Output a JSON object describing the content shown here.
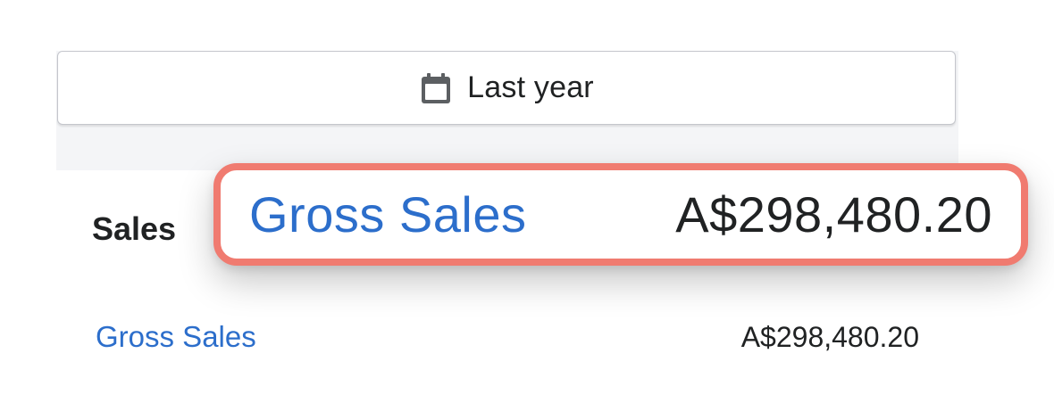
{
  "date_picker": {
    "label": "Last year",
    "icon": "calendar-icon"
  },
  "section": {
    "title": "Sales"
  },
  "rows": [
    {
      "label": "Gross Sales",
      "value": "A$298,480.20"
    }
  ],
  "callout": {
    "label": "Gross Sales",
    "value": "A$298,480.20"
  },
  "colors": {
    "link": "#2c6ecb",
    "text": "#202223",
    "highlight_border": "#f07b70",
    "panel_bg": "#f4f5f7"
  }
}
